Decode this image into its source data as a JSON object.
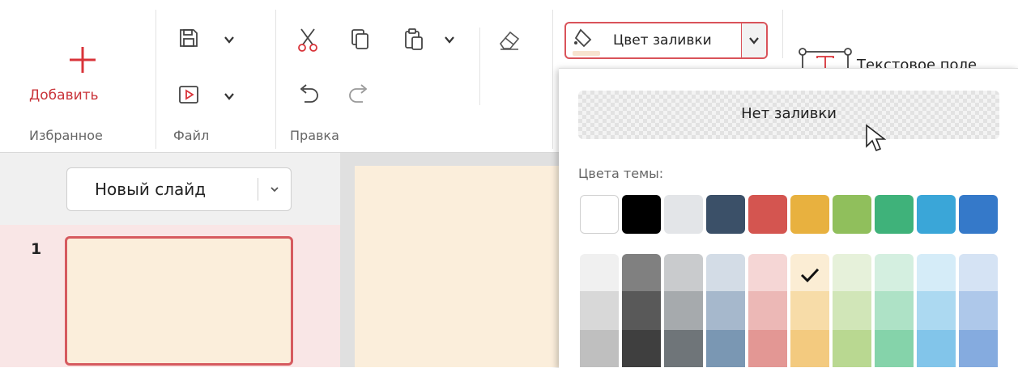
{
  "toolbar": {
    "add_label": "Добавить",
    "group_favorites": "Избранное",
    "group_file": "Файл",
    "group_edit": "Правка",
    "fill_color_label": "Цвет заливки",
    "text_field_label": "Текстовое поле"
  },
  "slides_panel": {
    "new_slide_label": "Новый слайд",
    "slide_number": "1"
  },
  "fill_dropdown": {
    "no_fill_label": "Нет заливки",
    "theme_colors_label": "Цвета темы:",
    "theme_colors": [
      "#ffffff",
      "#000000",
      "#e3e5e8",
      "#3b5068",
      "#d45550",
      "#e8b13f",
      "#90bf5c",
      "#3fb27a",
      "#3aa6d8",
      "#3579c9"
    ],
    "selected_shade": "column 6, row 1",
    "accent_color": "#d9535a",
    "shades": [
      [
        "#f0f0f0",
        "#d8d8d8",
        "#bfbfbf"
      ],
      [
        "#808080",
        "#595959",
        "#3f3f3f"
      ],
      [
        "#c9cbcd",
        "#a6aaad",
        "#6f7579"
      ],
      [
        "#d3dce6",
        "#a6b8cc",
        "#7a97b3"
      ],
      [
        "#f5d6d5",
        "#ecb8b6",
        "#e39794"
      ],
      [
        "#fbedd4",
        "#f7dca8",
        "#f3ca7f"
      ],
      [
        "#e6f1da",
        "#d1e6b8",
        "#b9d891"
      ],
      [
        "#d4efe0",
        "#aee2c6",
        "#85d3aa"
      ],
      [
        "#d5ecf8",
        "#acd9f1",
        "#82c5ea"
      ],
      [
        "#d5e3f4",
        "#aec8ea",
        "#85abdf"
      ]
    ]
  }
}
